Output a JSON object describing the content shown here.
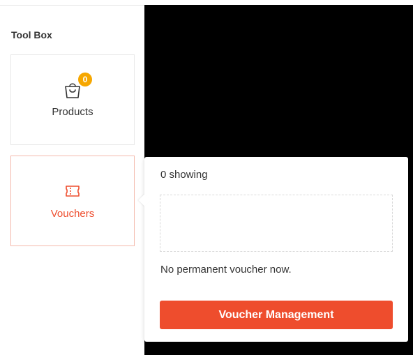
{
  "toolbox": {
    "title": "Tool Box",
    "items": [
      {
        "label": "Products",
        "icon": "shopping-bag-icon",
        "badge": "0"
      },
      {
        "label": "Vouchers",
        "icon": "ticket-icon",
        "active": true
      }
    ]
  },
  "voucher_popover": {
    "count_text": "0 showing",
    "empty_text": "No permanent voucher now.",
    "button_label": "Voucher Management"
  },
  "colors": {
    "accent": "#ee4d2d",
    "badge": "#f6a700",
    "active_border": "#f4b9ab",
    "background_panel": "#000000"
  }
}
